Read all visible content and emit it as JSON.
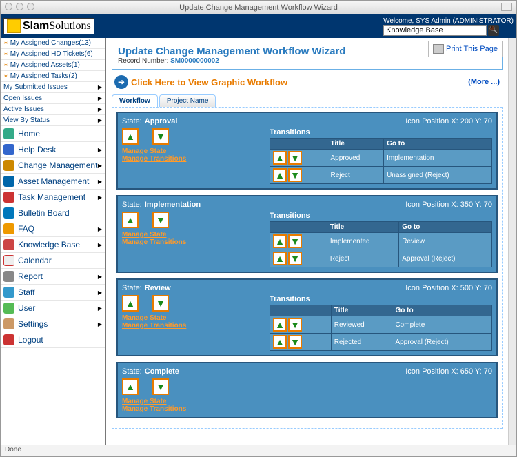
{
  "window_title": "Update Change Management Workflow Wizard",
  "header": {
    "brand_bold": "Slam",
    "brand_rest": "Solutions",
    "welcome": "Welcome, SYS Admin (ADMINISTRATOR)",
    "search_value": "Knowledge Base"
  },
  "sidebar": {
    "quick": [
      {
        "label": "My Assigned Changes(13)"
      },
      {
        "label": "My Assigned HD Tickets(6)"
      },
      {
        "label": "My Assigned Assets(1)"
      },
      {
        "label": "My Assigned Tasks(2)"
      },
      {
        "label": "My Submitted Issues",
        "caret": true
      },
      {
        "label": "Open Issues",
        "caret": true
      },
      {
        "label": "Active Issues",
        "caret": true
      },
      {
        "label": "View By Status",
        "caret": true
      }
    ],
    "nav": [
      {
        "label": "Home",
        "icon": "ic-home"
      },
      {
        "label": "Help Desk",
        "icon": "ic-help",
        "caret": true
      },
      {
        "label": "Change Management",
        "icon": "ic-change",
        "caret": true
      },
      {
        "label": "Asset Management",
        "icon": "ic-asset",
        "caret": true
      },
      {
        "label": "Task Management",
        "icon": "ic-task",
        "caret": true
      },
      {
        "label": "Bulletin Board",
        "icon": "ic-bb"
      },
      {
        "label": "FAQ",
        "icon": "ic-faq",
        "caret": true
      },
      {
        "label": "Knowledge Base",
        "icon": "ic-kb",
        "caret": true
      },
      {
        "label": "Calendar",
        "icon": "ic-cal"
      },
      {
        "label": "Report",
        "icon": "ic-rep",
        "caret": true
      },
      {
        "label": "Staff",
        "icon": "ic-staff",
        "caret": true
      },
      {
        "label": "User",
        "icon": "ic-user",
        "caret": true
      },
      {
        "label": "Settings",
        "icon": "ic-set",
        "caret": true
      },
      {
        "label": "Logout",
        "icon": "ic-logout"
      }
    ]
  },
  "page": {
    "title": "Update Change Management Workflow Wizard",
    "record_label": "Record Number:",
    "record_number": "SM0000000002",
    "print_link": "Print This Page",
    "workflow_link": "Click Here to View Graphic Workflow",
    "more": "(More ...)",
    "tabs": [
      "Workflow",
      "Project Name"
    ],
    "state_label": "State:",
    "icon_pos_label": "Icon Position X:",
    "y_label": "Y:",
    "trans_head": "Transitions",
    "col_title": "Title",
    "col_goto": "Go to",
    "manage_state": "Manage State",
    "manage_trans": "Manage Transitions",
    "states": [
      {
        "name": "Approval",
        "x": "200",
        "y": "70",
        "transitions": [
          {
            "title": "Approved",
            "goto": "Implementation"
          },
          {
            "title": "Reject",
            "goto": "Unassigned (Reject)"
          }
        ]
      },
      {
        "name": "Implementation",
        "x": "350",
        "y": "70",
        "transitions": [
          {
            "title": "Implemented",
            "goto": "Review"
          },
          {
            "title": "Reject",
            "goto": "Approval (Reject)"
          }
        ]
      },
      {
        "name": "Review",
        "x": "500",
        "y": "70",
        "transitions": [
          {
            "title": "Reviewed",
            "goto": "Complete"
          },
          {
            "title": "Rejected",
            "goto": "Approval (Reject)"
          }
        ]
      },
      {
        "name": "Complete",
        "x": "650",
        "y": "70",
        "transitions": []
      }
    ]
  },
  "status_bar": "Done"
}
